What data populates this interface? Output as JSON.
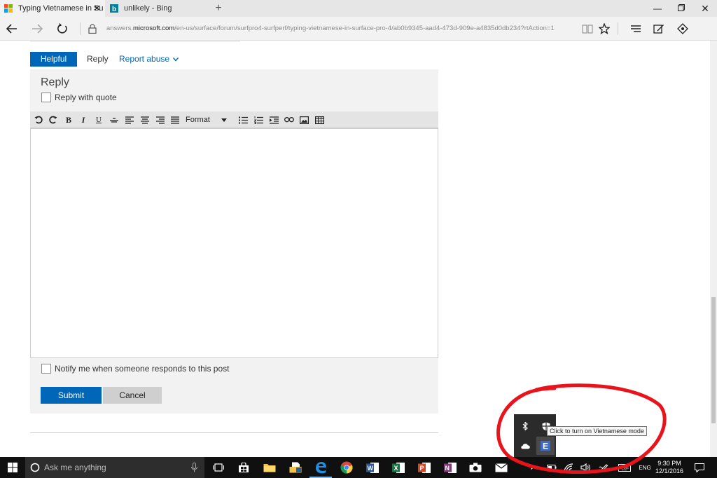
{
  "browser": {
    "tabs": [
      {
        "label": "Typing Vietnamese in Su",
        "icon": "microsoft-logo",
        "active": true
      },
      {
        "label": "unlikely - Bing",
        "icon": "bing-logo",
        "active": false
      }
    ],
    "new_tab": "+",
    "address": {
      "host_prefix": "answers.",
      "host_domain": "microsoft.com",
      "path": "/en-us/surface/forum/surfpro4-surfperf/typing-vietnamese-in-surface-pro-4/ab0b9345-aad4-473d-909e-a4835d0db234?rtAction=1"
    }
  },
  "post_actions": {
    "helpful": "Helpful",
    "reply": "Reply",
    "report_abuse": "Report abuse"
  },
  "reply_form": {
    "heading": "Reply",
    "reply_with_quote": "Reply with quote",
    "format_label": "Format",
    "notify_label": "Notify me when someone responds to this post",
    "submit": "Submit",
    "cancel": "Cancel"
  },
  "tray": {
    "tooltip": "Click to turn on Vietnamese mode",
    "annotation_color": "#e8141b"
  },
  "taskbar": {
    "search_placeholder": "Ask me anything",
    "time": "9:30 PM",
    "date": "12/1/2016",
    "language_indicator": "ENG"
  }
}
